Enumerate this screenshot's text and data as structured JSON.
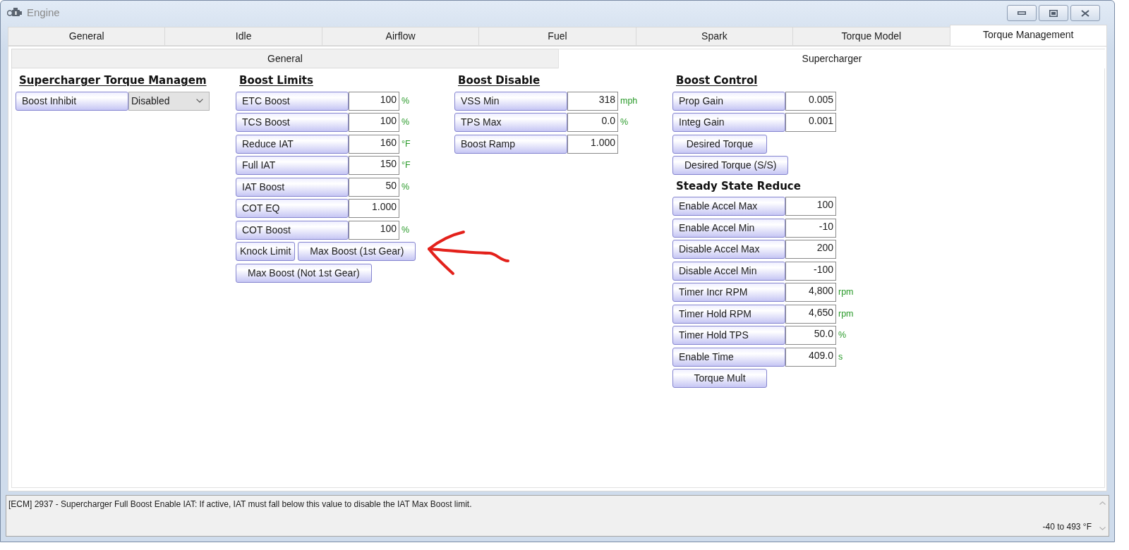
{
  "window": {
    "title": "Engine"
  },
  "tabs": [
    {
      "label": "General",
      "selected": false
    },
    {
      "label": "Idle",
      "selected": false
    },
    {
      "label": "Airflow",
      "selected": false
    },
    {
      "label": "Fuel",
      "selected": false
    },
    {
      "label": "Spark",
      "selected": false
    },
    {
      "label": "Torque Model",
      "selected": false
    },
    {
      "label": "Torque Management",
      "selected": true
    }
  ],
  "subtabs": [
    {
      "label": "General",
      "selected": false
    },
    {
      "label": "Supercharger",
      "selected": true
    }
  ],
  "columns": [
    {
      "sections": [
        {
          "title": "Supercharger Torque Managem",
          "underlined": true,
          "items": [
            {
              "kind": "dropdown",
              "label": "Boost Inhibit",
              "value": "Disabled"
            }
          ]
        }
      ]
    },
    {
      "sections": [
        {
          "title": "Boost Limits",
          "underlined": true,
          "items": [
            {
              "kind": "field",
              "label": "ETC Boost",
              "value": "100",
              "unit": "%"
            },
            {
              "kind": "field",
              "label": "TCS Boost",
              "value": "100",
              "unit": "%"
            },
            {
              "kind": "field",
              "label": "Reduce IAT",
              "value": "160",
              "unit": "°F"
            },
            {
              "kind": "field",
              "label": "Full IAT",
              "value": "150",
              "unit": "°F"
            },
            {
              "kind": "field",
              "label": "IAT Boost",
              "value": "50",
              "unit": "%"
            },
            {
              "kind": "field",
              "label": "COT EQ",
              "value": "1.000"
            },
            {
              "kind": "field",
              "label": "COT Boost",
              "value": "100",
              "unit": "%"
            },
            {
              "kind": "buttons",
              "buttons": [
                "Knock Limit",
                "Max Boost (1st Gear)"
              ]
            },
            {
              "kind": "buttons",
              "buttons": [
                "Max Boost (Not 1st Gear)"
              ]
            }
          ]
        }
      ]
    },
    {
      "sections": [
        {
          "title": "Boost Disable",
          "underlined": true,
          "items": [
            {
              "kind": "field",
              "label": "VSS Min",
              "value": "318",
              "unit": "mph"
            },
            {
              "kind": "field",
              "label": "TPS Max",
              "value": "0.0",
              "unit": "%"
            },
            {
              "kind": "field",
              "label": "Boost Ramp",
              "value": "1.000"
            }
          ]
        }
      ]
    },
    {
      "sections": [
        {
          "title": "Boost Control",
          "underlined": true,
          "items": [
            {
              "kind": "field",
              "label": "Prop Gain",
              "value": "0.005"
            },
            {
              "kind": "field",
              "label": "Integ Gain",
              "value": "0.001"
            },
            {
              "kind": "buttons",
              "buttons": [
                "Desired Torque"
              ]
            },
            {
              "kind": "buttons",
              "buttons": [
                "Desired Torque (S/S)"
              ]
            }
          ]
        },
        {
          "title": "Steady State Reduce",
          "underlined": false,
          "items": [
            {
              "kind": "field",
              "label": "Enable Accel Max",
              "value": "100"
            },
            {
              "kind": "field",
              "label": "Enable Accel Min",
              "value": "-10"
            },
            {
              "kind": "field",
              "label": "Disable Accel Max",
              "value": "200"
            },
            {
              "kind": "field",
              "label": "Disable Accel Min",
              "value": "-100"
            },
            {
              "kind": "field",
              "label": "Timer Incr RPM",
              "value": "4,800",
              "unit": "rpm"
            },
            {
              "kind": "field",
              "label": "Timer Hold RPM",
              "value": "4,650",
              "unit": "rpm"
            },
            {
              "kind": "field",
              "label": "Timer Hold TPS",
              "value": "50.0",
              "unit": "%"
            },
            {
              "kind": "field",
              "label": "Enable Time",
              "value": "409.0",
              "unit": "s"
            },
            {
              "kind": "buttons",
              "buttons": [
                "Torque Mult"
              ]
            }
          ]
        }
      ]
    }
  ],
  "description": {
    "text": "[ECM] 2937 - Supercharger Full Boost Enable IAT: If active, IAT must fall below this value to disable the IAT Max Boost limit.",
    "range": "-40 to 493 °F"
  }
}
